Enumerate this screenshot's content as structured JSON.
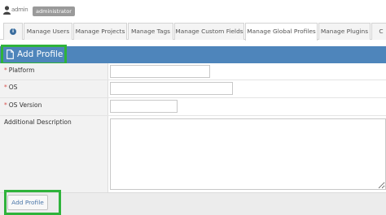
{
  "user": {
    "name": "admin",
    "role": "administrator",
    "icon": "user-icon"
  },
  "tabs": [
    {
      "label": "",
      "icon": "info-icon",
      "active": false
    },
    {
      "label": "Manage Users",
      "active": false
    },
    {
      "label": "Manage Projects",
      "active": false
    },
    {
      "label": "Manage Tags",
      "active": false
    },
    {
      "label": "Manage Custom Fields",
      "active": false
    },
    {
      "label": "Manage Global Profiles",
      "active": true
    },
    {
      "label": "Manage Plugins",
      "active": false
    },
    {
      "label": "C",
      "active": false
    }
  ],
  "panel": {
    "title": "Add Profile",
    "icon": "file-icon",
    "header_color": "#4e85bb",
    "highlight_color": "#2fb33b"
  },
  "form": {
    "platform_label": "Platform",
    "os_label": "OS",
    "os_version_label": "OS Version",
    "description_label": "Additional Description",
    "required_marker": "*",
    "platform_value": "",
    "os_value": "",
    "os_version_value": "",
    "description_value": ""
  },
  "footer": {
    "submit_label": "Add Profile"
  }
}
